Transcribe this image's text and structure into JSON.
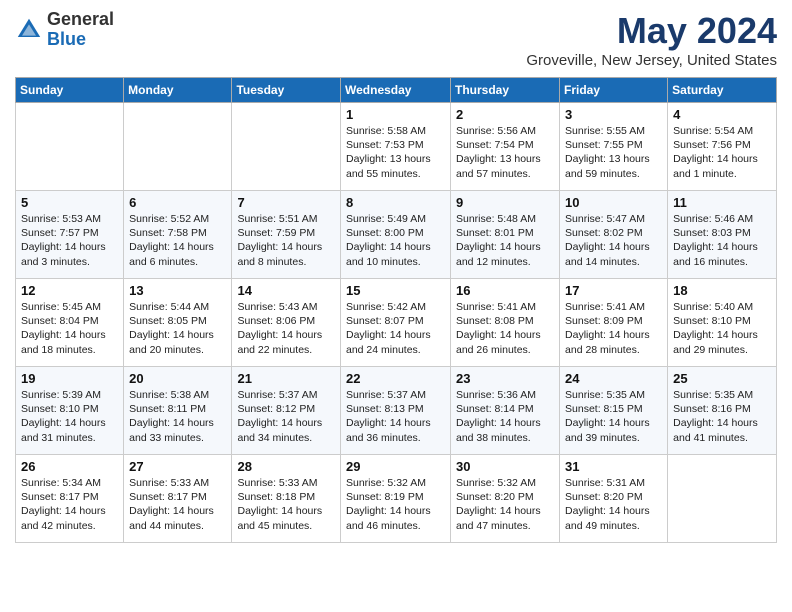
{
  "header": {
    "logo_general": "General",
    "logo_blue": "Blue",
    "month": "May 2024",
    "location": "Groveville, New Jersey, United States"
  },
  "columns": [
    "Sunday",
    "Monday",
    "Tuesday",
    "Wednesday",
    "Thursday",
    "Friday",
    "Saturday"
  ],
  "weeks": [
    [
      {
        "day": "",
        "info": ""
      },
      {
        "day": "",
        "info": ""
      },
      {
        "day": "",
        "info": ""
      },
      {
        "day": "1",
        "info": "Sunrise: 5:58 AM\nSunset: 7:53 PM\nDaylight: 13 hours\nand 55 minutes."
      },
      {
        "day": "2",
        "info": "Sunrise: 5:56 AM\nSunset: 7:54 PM\nDaylight: 13 hours\nand 57 minutes."
      },
      {
        "day": "3",
        "info": "Sunrise: 5:55 AM\nSunset: 7:55 PM\nDaylight: 13 hours\nand 59 minutes."
      },
      {
        "day": "4",
        "info": "Sunrise: 5:54 AM\nSunset: 7:56 PM\nDaylight: 14 hours\nand 1 minute."
      }
    ],
    [
      {
        "day": "5",
        "info": "Sunrise: 5:53 AM\nSunset: 7:57 PM\nDaylight: 14 hours\nand 3 minutes."
      },
      {
        "day": "6",
        "info": "Sunrise: 5:52 AM\nSunset: 7:58 PM\nDaylight: 14 hours\nand 6 minutes."
      },
      {
        "day": "7",
        "info": "Sunrise: 5:51 AM\nSunset: 7:59 PM\nDaylight: 14 hours\nand 8 minutes."
      },
      {
        "day": "8",
        "info": "Sunrise: 5:49 AM\nSunset: 8:00 PM\nDaylight: 14 hours\nand 10 minutes."
      },
      {
        "day": "9",
        "info": "Sunrise: 5:48 AM\nSunset: 8:01 PM\nDaylight: 14 hours\nand 12 minutes."
      },
      {
        "day": "10",
        "info": "Sunrise: 5:47 AM\nSunset: 8:02 PM\nDaylight: 14 hours\nand 14 minutes."
      },
      {
        "day": "11",
        "info": "Sunrise: 5:46 AM\nSunset: 8:03 PM\nDaylight: 14 hours\nand 16 minutes."
      }
    ],
    [
      {
        "day": "12",
        "info": "Sunrise: 5:45 AM\nSunset: 8:04 PM\nDaylight: 14 hours\nand 18 minutes."
      },
      {
        "day": "13",
        "info": "Sunrise: 5:44 AM\nSunset: 8:05 PM\nDaylight: 14 hours\nand 20 minutes."
      },
      {
        "day": "14",
        "info": "Sunrise: 5:43 AM\nSunset: 8:06 PM\nDaylight: 14 hours\nand 22 minutes."
      },
      {
        "day": "15",
        "info": "Sunrise: 5:42 AM\nSunset: 8:07 PM\nDaylight: 14 hours\nand 24 minutes."
      },
      {
        "day": "16",
        "info": "Sunrise: 5:41 AM\nSunset: 8:08 PM\nDaylight: 14 hours\nand 26 minutes."
      },
      {
        "day": "17",
        "info": "Sunrise: 5:41 AM\nSunset: 8:09 PM\nDaylight: 14 hours\nand 28 minutes."
      },
      {
        "day": "18",
        "info": "Sunrise: 5:40 AM\nSunset: 8:10 PM\nDaylight: 14 hours\nand 29 minutes."
      }
    ],
    [
      {
        "day": "19",
        "info": "Sunrise: 5:39 AM\nSunset: 8:10 PM\nDaylight: 14 hours\nand 31 minutes."
      },
      {
        "day": "20",
        "info": "Sunrise: 5:38 AM\nSunset: 8:11 PM\nDaylight: 14 hours\nand 33 minutes."
      },
      {
        "day": "21",
        "info": "Sunrise: 5:37 AM\nSunset: 8:12 PM\nDaylight: 14 hours\nand 34 minutes."
      },
      {
        "day": "22",
        "info": "Sunrise: 5:37 AM\nSunset: 8:13 PM\nDaylight: 14 hours\nand 36 minutes."
      },
      {
        "day": "23",
        "info": "Sunrise: 5:36 AM\nSunset: 8:14 PM\nDaylight: 14 hours\nand 38 minutes."
      },
      {
        "day": "24",
        "info": "Sunrise: 5:35 AM\nSunset: 8:15 PM\nDaylight: 14 hours\nand 39 minutes."
      },
      {
        "day": "25",
        "info": "Sunrise: 5:35 AM\nSunset: 8:16 PM\nDaylight: 14 hours\nand 41 minutes."
      }
    ],
    [
      {
        "day": "26",
        "info": "Sunrise: 5:34 AM\nSunset: 8:17 PM\nDaylight: 14 hours\nand 42 minutes."
      },
      {
        "day": "27",
        "info": "Sunrise: 5:33 AM\nSunset: 8:17 PM\nDaylight: 14 hours\nand 44 minutes."
      },
      {
        "day": "28",
        "info": "Sunrise: 5:33 AM\nSunset: 8:18 PM\nDaylight: 14 hours\nand 45 minutes."
      },
      {
        "day": "29",
        "info": "Sunrise: 5:32 AM\nSunset: 8:19 PM\nDaylight: 14 hours\nand 46 minutes."
      },
      {
        "day": "30",
        "info": "Sunrise: 5:32 AM\nSunset: 8:20 PM\nDaylight: 14 hours\nand 47 minutes."
      },
      {
        "day": "31",
        "info": "Sunrise: 5:31 AM\nSunset: 8:20 PM\nDaylight: 14 hours\nand 49 minutes."
      },
      {
        "day": "",
        "info": ""
      }
    ]
  ]
}
